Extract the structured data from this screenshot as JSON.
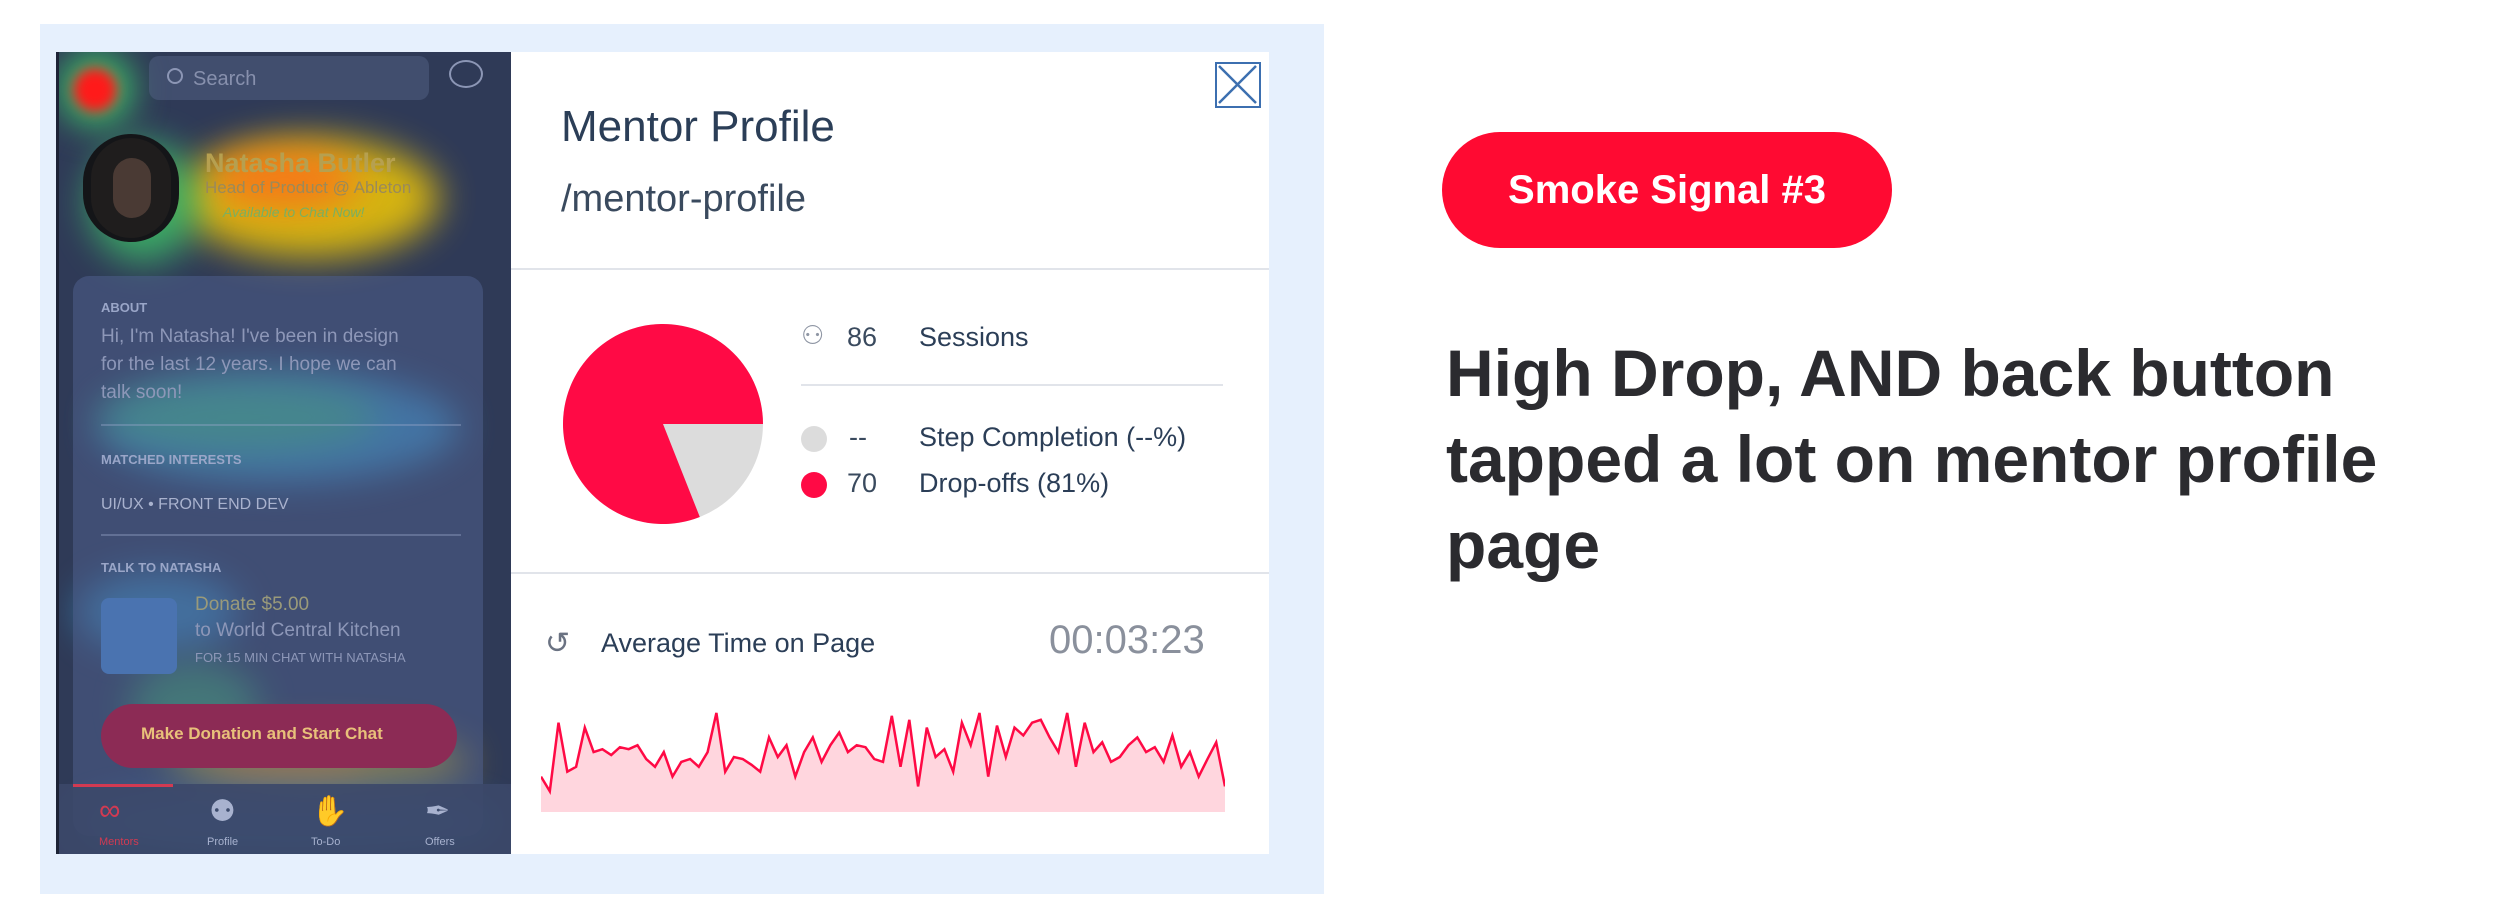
{
  "phone_screen": {
    "search_placeholder": "Search",
    "profile": {
      "name": "Natasha Butler",
      "title": "Head of Product @ Ableton",
      "status": "Available to Chat Now!"
    },
    "about": {
      "heading": "ABOUT",
      "lines": [
        "Hi, I'm Natasha! I've been in design",
        "for the last 12 years. I hope we can",
        "talk soon!"
      ]
    },
    "interests": {
      "heading": "MATCHED INTERESTS",
      "value": "UI/UX • FRONT END DEV"
    },
    "talk": {
      "heading": "TALK TO NATASHA",
      "donate_line1": "Donate $5.00",
      "donate_line2": "to World Central Kitchen",
      "donate_line3": "FOR 15 MIN CHAT WITH NATASHA",
      "button": "Make Donation and Start Chat"
    },
    "tabs": [
      {
        "label": "Mentors",
        "icon": "glasses-icon"
      },
      {
        "label": "Profile",
        "icon": "person-icon"
      },
      {
        "label": "To-Do",
        "icon": "hands-icon"
      },
      {
        "label": "Offers",
        "icon": "carrot-icon"
      }
    ],
    "heat_colors": {
      "hot": "#ff1a1a",
      "warm": "#ffd200",
      "mild": "#3fd06a",
      "cool": "#3ab4f0"
    }
  },
  "analytics": {
    "title": "Mentor Profile",
    "path": "/mentor-profile",
    "sessions": {
      "value": "86",
      "label": "Sessions"
    },
    "step_completion": {
      "value": "--",
      "label": "Step Completion (--%)"
    },
    "drop_offs": {
      "value": "70",
      "label": "Drop-offs (81%)"
    },
    "avg_time": {
      "label": "Average Time on Page",
      "value": "00:03:23"
    },
    "pie": {
      "drop_off_percent": 81,
      "completion_percent": 19
    },
    "sparkline": [
      0.3,
      0.15,
      0.85,
      0.35,
      0.4,
      0.8,
      0.55,
      0.58,
      0.52,
      0.6,
      0.58,
      0.62,
      0.48,
      0.4,
      0.55,
      0.3,
      0.45,
      0.48,
      0.4,
      0.55,
      0.95,
      0.35,
      0.5,
      0.48,
      0.42,
      0.35,
      0.7,
      0.5,
      0.62,
      0.3,
      0.55,
      0.7,
      0.45,
      0.62,
      0.75,
      0.55,
      0.62,
      0.6,
      0.48,
      0.45,
      0.92,
      0.4,
      0.88,
      0.2,
      0.8,
      0.5,
      0.58,
      0.35,
      0.85,
      0.62,
      0.95,
      0.3,
      0.82,
      0.5,
      0.8,
      0.72,
      0.85,
      0.88,
      0.7,
      0.55,
      0.95,
      0.4,
      0.85,
      0.55,
      0.65,
      0.45,
      0.5,
      0.62,
      0.7,
      0.55,
      0.6,
      0.45,
      0.72,
      0.4,
      0.55,
      0.3,
      0.48,
      0.65,
      0.2
    ],
    "colors": {
      "drop": "#ff0a45",
      "completion": "#dcdcdc",
      "spark_fill": "#ffd6de"
    }
  },
  "badge": "Smoke Signal #3",
  "headline": "High Drop, AND back button tapped a lot on mentor profile page"
}
